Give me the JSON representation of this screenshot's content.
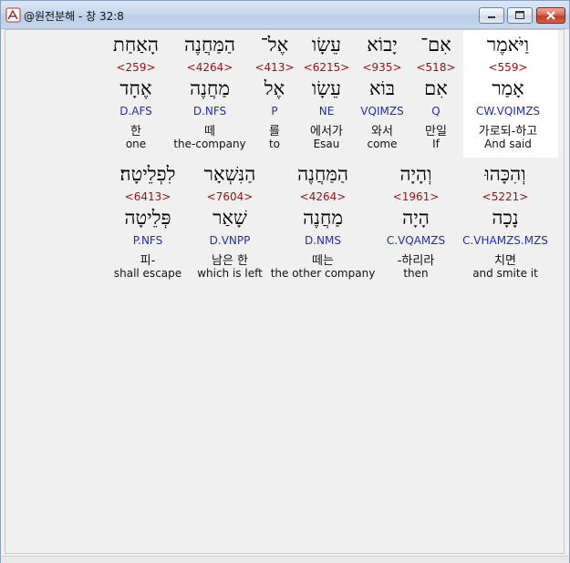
{
  "window": {
    "title": "@원전분해 - 창 32:8"
  },
  "rows": [
    [
      {
        "surface": "וַיֹּאמֶר",
        "strong": "<559>",
        "lemma": "אָמַר",
        "morph": "CW.VQIMZS",
        "ko": "가로되-하고",
        "en": "And said"
      },
      {
        "surface": "אִם־",
        "strong": "<518>",
        "lemma": "אִם",
        "morph": "Q",
        "ko": "만일",
        "en": "If"
      },
      {
        "surface": "יָבוֹא",
        "strong": "<935>",
        "lemma": "בּוֹא",
        "morph": "VQIMZS",
        "ko": "와서",
        "en": "come"
      },
      {
        "surface": "עֵשָׂו",
        "strong": "<6215>",
        "lemma": "עֵשָׂו",
        "morph": "NE",
        "ko": "에서가",
        "en": "Esau"
      },
      {
        "surface": "אֶל־",
        "strong": "<413>",
        "lemma": "אֶל",
        "morph": "P",
        "ko": "를",
        "en": "to"
      },
      {
        "surface": "הַמַּחֲנֶה",
        "strong": "<4264>",
        "lemma": "מַחֲנֶה",
        "morph": "D.NFS",
        "ko": "떼",
        "en": "the-company"
      },
      {
        "surface": "הָאַחַת",
        "strong": "<259>",
        "lemma": "אֶחָד",
        "morph": "D.AFS",
        "ko": "한",
        "en": "one"
      }
    ],
    [
      {
        "surface": "וְהִכָּהוּ",
        "strong": "<5221>",
        "lemma": "נָכָה",
        "morph": "C.VHAMZS.MZS",
        "ko": "치면",
        "en": "and smite it"
      },
      {
        "surface": "וְהָיָה",
        "strong": "<1961>",
        "lemma": "הָיָה",
        "morph": "C.VQAMZS",
        "ko": "-하리라",
        "en": "then"
      },
      {
        "surface": "הַמַּחֲנֶה",
        "strong": "<4264>",
        "lemma": "מַחֲנֶה",
        "morph": "D.NMS",
        "ko": "떼는",
        "en": "the other company"
      },
      {
        "surface": "הַנִּשְׁאָר",
        "strong": "<7604>",
        "lemma": "שָׁאַר",
        "morph": "D.VNPP",
        "ko": "남은 한",
        "en": "which is left"
      },
      {
        "surface": "לִפְלֵיטָה׃",
        "strong": "<6413>",
        "lemma": "פְּלֵיטָה",
        "morph": "P.NFS",
        "ko": "피-",
        "en": "shall escape"
      }
    ]
  ]
}
